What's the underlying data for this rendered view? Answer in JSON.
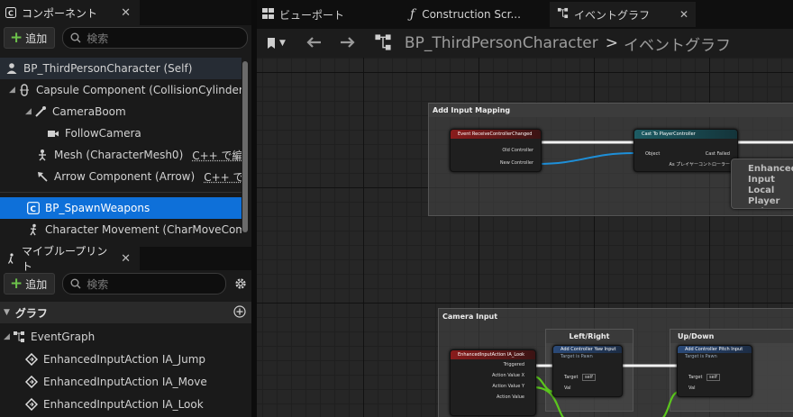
{
  "components_panel": {
    "tab_label": "コンポーネント",
    "add_label": "追加",
    "search_placeholder": "検索",
    "tree": [
      {
        "label": "BP_ThirdPersonCharacter (Self)",
        "icon": "person-icon"
      },
      {
        "label": "Capsule Component (CollisionCylinder)",
        "icon": "capsule-icon"
      },
      {
        "label": "CameraBoom",
        "icon": "spring-arm-icon"
      },
      {
        "label": "FollowCamera",
        "icon": "camera-icon"
      },
      {
        "label": "Mesh (CharacterMesh0)",
        "cpp": "C++ で編集",
        "icon": "skeleton-icon"
      },
      {
        "label": "Arrow Component (Arrow)",
        "cpp": "C++ で編集",
        "icon": "arrow-icon"
      },
      {
        "label": "BP_SpawnWeapons",
        "icon": "blueprint-icon"
      },
      {
        "label": "Character Movement (CharMoveComp)",
        "icon": "walking-icon"
      }
    ]
  },
  "myblueprint_panel": {
    "tab_label": "マイブループリント",
    "add_label": "追加",
    "search_placeholder": "検索",
    "section": "グラフ",
    "items": [
      {
        "label": "EventGraph",
        "icon": "graph-icon"
      },
      {
        "label": "EnhancedInputAction IA_Jump",
        "icon": "input-action-icon"
      },
      {
        "label": "EnhancedInputAction IA_Move",
        "icon": "input-action-icon"
      },
      {
        "label": "EnhancedInputAction IA_Look",
        "icon": "input-action-icon"
      }
    ]
  },
  "editor_tabs": [
    {
      "label": "ビューポート",
      "icon": "viewport-icon"
    },
    {
      "label": "Construction Scr...",
      "icon": "function-icon"
    },
    {
      "label": "イベントグラフ",
      "icon": "graph-icon"
    }
  ],
  "breadcrumb": {
    "blueprint": "BP_ThirdPersonCharacter",
    "separator": ">",
    "graph": "イベントグラフ"
  },
  "graph": {
    "comments": [
      {
        "title": "Add Input Mapping"
      },
      {
        "title": "Camera Input"
      }
    ],
    "sub_comments": [
      "Left/Right",
      "Up/Down"
    ],
    "nodes": {
      "event_controller_changed": {
        "title": "Event ReceiveControllerChanged",
        "pins": [
          "Old Controller",
          "New Controller"
        ]
      },
      "cast_to_player_controller": {
        "title": "Cast To PlayerController",
        "pins": [
          "Object",
          "Cast Failed",
          "As プレイヤーコントローラー"
        ]
      },
      "enhanced_subsystem": {
        "title": "Enhanced Input Local Player Subsystem"
      },
      "ia_look": {
        "title": "EnhancedInputAction IA_Look",
        "pins": [
          "Triggered",
          "Action Value X",
          "Action Value Y",
          "Action Value"
        ]
      },
      "add_yaw": {
        "title": "Add Controller Yaw Input",
        "subtitle": "Target is Pawn",
        "pins": [
          "Target",
          "self",
          "Val"
        ]
      },
      "add_pitch": {
        "title": "Add Controller Pitch Input",
        "subtitle": "Target is Pawn",
        "pins": [
          "Target",
          "self",
          "Val"
        ]
      }
    }
  },
  "colors": {
    "selection": "#0e70d9",
    "add_plus": "#6dc24b",
    "event_node": "#8a1c1c",
    "cast_node": "#1d5c64",
    "function_node": "#2b4a78",
    "object_wire": "#1e8fd8",
    "float_wire": "#5bc61d"
  }
}
